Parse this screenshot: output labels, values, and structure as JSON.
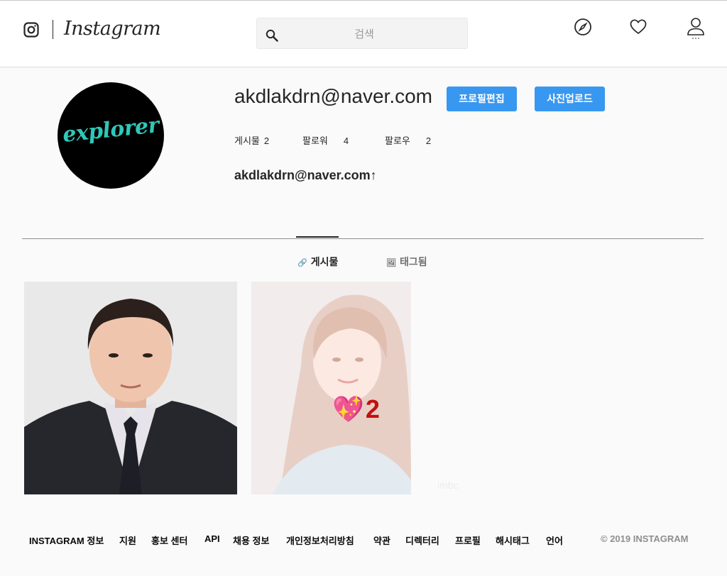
{
  "header": {
    "logo_text": "Instagram",
    "search_placeholder": "검색"
  },
  "profile": {
    "username": "akdlakdrn@naver.com",
    "avatar_text": "explorer",
    "edit_button": "프로필편집",
    "upload_button": "사진업로드",
    "stats": [
      {
        "label": "게시물",
        "value": "2"
      },
      {
        "label": "팔로워",
        "value": "4"
      },
      {
        "label": "팔로우",
        "value": "2"
      }
    ],
    "fullname": "akdlakdrn@naver.com↑"
  },
  "tabs": [
    {
      "icon": "🔗",
      "label": "게시물"
    },
    {
      "icon": "🖼",
      "label": "태그됨"
    }
  ],
  "posts": [
    {
      "likes_icon": "💖",
      "likes": "2"
    }
  ],
  "footer": {
    "links": [
      "INSTAGRAM 정보",
      "지원",
      "홍보 센터",
      "API",
      "채용 정보",
      "개인정보처리방침",
      "약관",
      "디렉터리",
      "프로필",
      "해시태그",
      "언어"
    ],
    "copyright": "© 2019 INSTAGRAM"
  }
}
